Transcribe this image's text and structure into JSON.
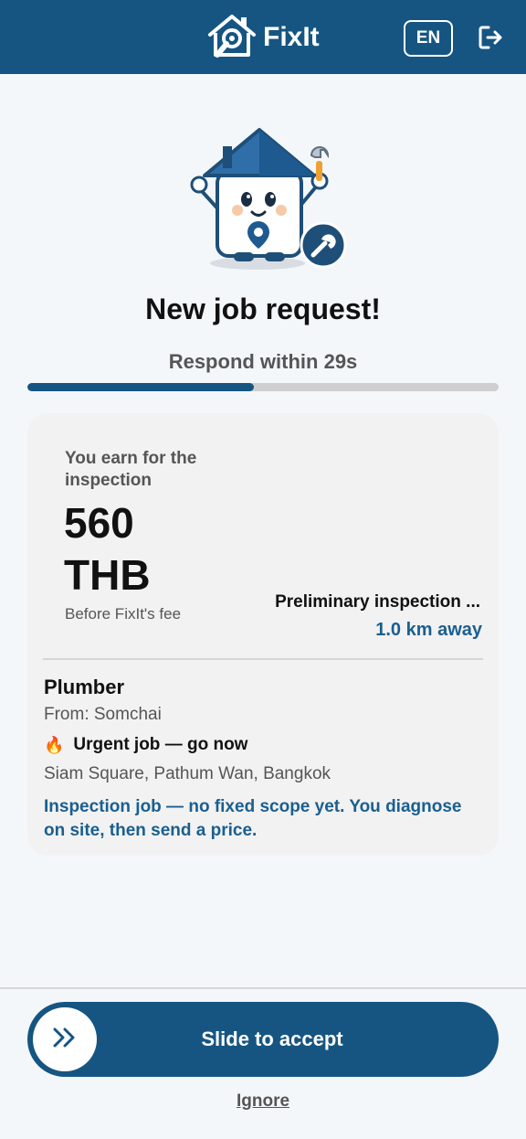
{
  "header": {
    "brand": "FixIt",
    "language": "EN",
    "icons": {
      "logo": "house-wrench-logo-icon",
      "logout": "logout-icon"
    }
  },
  "main": {
    "title": "New job request!",
    "countdown": "Respond within 29s",
    "countdown_progress": 0.48
  },
  "job": {
    "earn_label": "You earn for the inspection",
    "amount": "560 THB",
    "fee_note": "Before FixIt's fee",
    "job_type": "Preliminary inspection ...",
    "distance": "1.0 km away",
    "trade": "Plumber",
    "from": "From: Somchai",
    "urgent_icon": "🔥",
    "urgent": "Urgent job — go now",
    "address": "Siam Square, Pathum Wan, Bangkok",
    "note": "Inspection job — no fixed scope yet. You diagnose on site, then send a price."
  },
  "actions": {
    "slide_label": "Slide to accept",
    "ignore_label": "Ignore"
  },
  "colors": {
    "primary": "#165582",
    "accent_text": "#1a5f8f",
    "card_bg": "#f2f2f2",
    "page_bg": "#f4f7fa"
  }
}
